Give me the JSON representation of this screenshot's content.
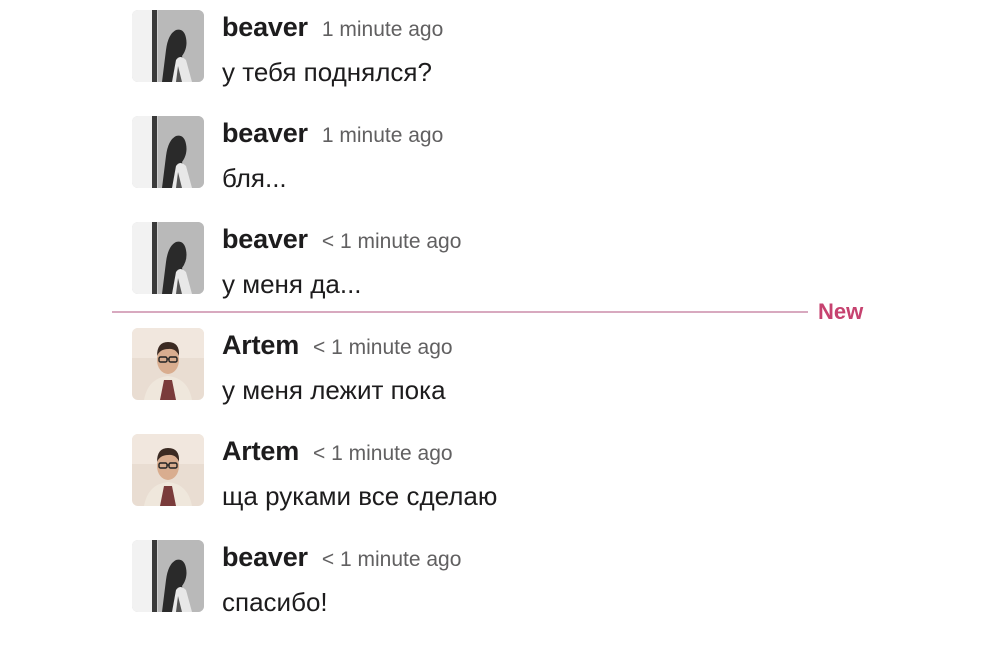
{
  "colors": {
    "divider": "#d8a9bf",
    "new_label": "#c6426f",
    "timestamp": "#616061",
    "text": "#1d1c1d"
  },
  "new_divider": {
    "label": "New"
  },
  "messages": [
    {
      "author": "beaver",
      "time": "1 minute ago",
      "text": "у тебя поднялся?",
      "avatar": "beaver-avatar"
    },
    {
      "author": "beaver",
      "time": "1 minute ago",
      "text": "бля...",
      "avatar": "beaver-avatar"
    },
    {
      "author": "beaver",
      "time": "< 1 minute ago",
      "text": "у меня да...",
      "avatar": "beaver-avatar"
    },
    {
      "author": "Artem",
      "time": "< 1 minute ago",
      "text": "у меня лежит пока",
      "avatar": "artem-avatar"
    },
    {
      "author": "Artem",
      "time": "< 1 minute ago",
      "text": "ща руками все сделаю",
      "avatar": "artem-avatar"
    },
    {
      "author": "beaver",
      "time": "< 1 minute ago",
      "text": "спасибо!",
      "avatar": "beaver-avatar"
    }
  ]
}
